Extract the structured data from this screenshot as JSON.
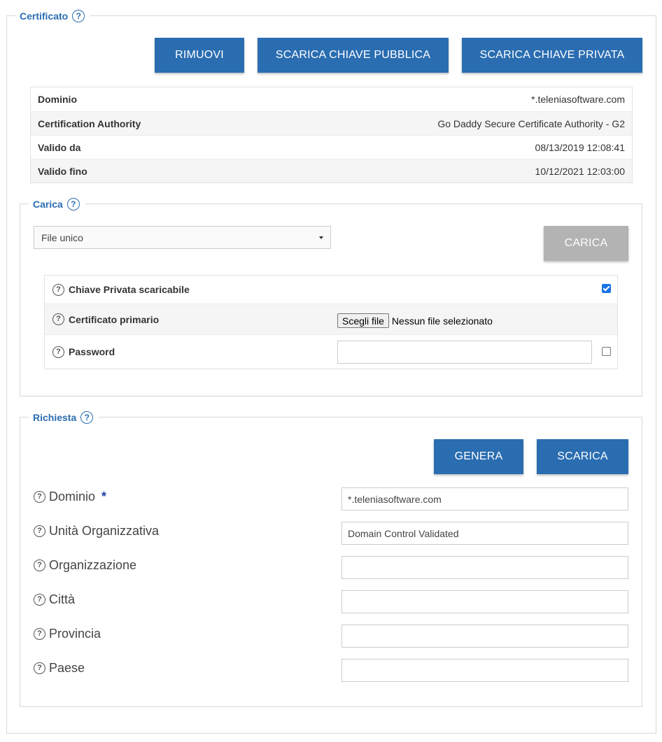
{
  "certificato": {
    "title": "Certificato",
    "buttons": {
      "rimuovi": "RIMUOVI",
      "scarica_pubblica": "SCARICA CHIAVE PUBBLICA",
      "scarica_privata": "SCARICA CHIAVE PRIVATA"
    },
    "info": [
      {
        "label": "Dominio",
        "value": "*.teleniasoftware.com"
      },
      {
        "label": "Certification Authority",
        "value": "Go Daddy Secure Certificate Authority - G2"
      },
      {
        "label": "Valido da",
        "value": "08/13/2019 12:08:41"
      },
      {
        "label": "Valido fino",
        "value": "10/12/2021 12:03:00"
      }
    ]
  },
  "carica": {
    "title": "Carica",
    "select_value": "File unico",
    "button": "CARICA",
    "options": {
      "chiave_privata": {
        "label": "Chiave Privata scaricabile",
        "checked": true
      },
      "certificato_primario": {
        "label": "Certificato primario",
        "file_button": "Scegli file",
        "file_text": "Nessun file selezionato"
      },
      "password": {
        "label": "Password",
        "value": "",
        "checked": false
      }
    }
  },
  "richiesta": {
    "title": "Richiesta",
    "buttons": {
      "genera": "GENERA",
      "scarica": "SCARICA"
    },
    "fields": [
      {
        "label": "Dominio",
        "required": "*",
        "value": "*.teleniasoftware.com"
      },
      {
        "label": "Unità Organizzativa",
        "value": "Domain Control Validated"
      },
      {
        "label": "Organizzazione",
        "value": ""
      },
      {
        "label": "Città",
        "value": ""
      },
      {
        "label": "Provincia",
        "value": ""
      },
      {
        "label": "Paese",
        "value": ""
      }
    ]
  },
  "icons": {
    "help": "?"
  },
  "colors": {
    "accent": "#2a6db1",
    "disabled": "#b3b3b3",
    "checkbox": "#1a73e8"
  }
}
